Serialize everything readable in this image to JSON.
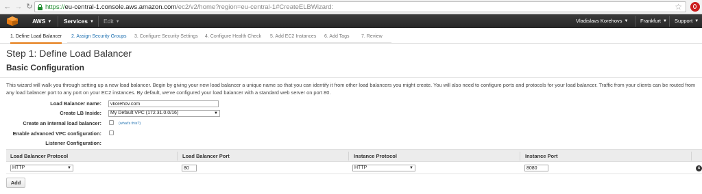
{
  "browser": {
    "url_secure": "https://",
    "url_host": "eu-central-1.console.aws.amazon.com",
    "url_path": "/ec2/v2/home?region=eu-central-1#CreateELBWizard:"
  },
  "aws_nav": {
    "brand": "AWS",
    "services": "Services",
    "edit": "Edit",
    "user": "Vladislavs Korehovs",
    "region": "Frankfurt",
    "support": "Support"
  },
  "wizard_tabs": [
    {
      "label": "1. Define Load Balancer",
      "state": "active"
    },
    {
      "label": "2. Assign Security Groups",
      "state": "link"
    },
    {
      "label": "3. Configure Security Settings",
      "state": "disabled"
    },
    {
      "label": "4. Configure Health Check",
      "state": "disabled"
    },
    {
      "label": "5. Add EC2 Instances",
      "state": "disabled"
    },
    {
      "label": "6. Add Tags",
      "state": "disabled"
    },
    {
      "label": "7. Review",
      "state": "disabled"
    }
  ],
  "page": {
    "title": "Step 1: Define Load Balancer",
    "section": "Basic Configuration",
    "intro": "This wizard will walk you through setting up a new load balancer. Begin by giving your new load balancer a unique name so that you can identify it from other load balancers you might create. You will also need to configure ports and protocols for your load balancer. Traffic from your clients can be routed from any load balancer port to any port on your EC2 instances. By default, we've configured your load balancer with a standard web server on port 80."
  },
  "form": {
    "name_label": "Load Balancer name:",
    "name_value": "vkorehov.com",
    "inside_label": "Create LB Inside:",
    "inside_value": "My Default VPC (172.31.0.0/16)",
    "internal_label": "Create an internal load balancer:",
    "internal_checked": false,
    "whats_this": "(what's this?)",
    "advanced_label": "Enable advanced VPC configuration:",
    "advanced_checked": false,
    "listener_label": "Listener Configuration:"
  },
  "listener_table": {
    "headers": [
      "Load Balancer Protocol",
      "Load Balancer Port",
      "Instance Protocol",
      "Instance Port"
    ],
    "row": {
      "lb_protocol": "HTTP",
      "lb_port": "80",
      "instance_protocol": "HTTP",
      "instance_port": "8080"
    }
  },
  "add_button": "Add",
  "colors": {
    "accent": "#e47911",
    "link": "#1b6eaf",
    "nav_bg": "#262626"
  }
}
